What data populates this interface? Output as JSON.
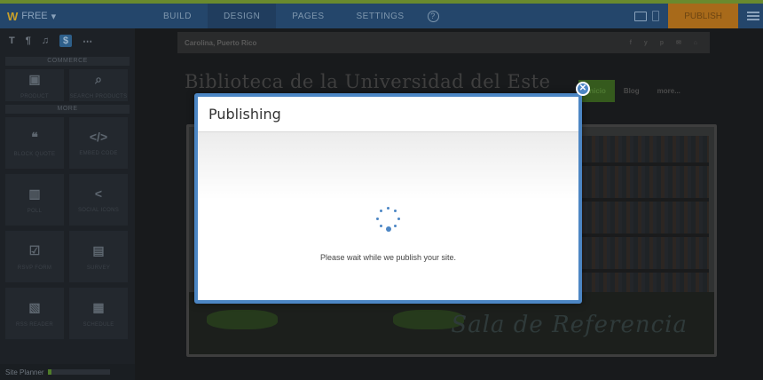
{
  "topbar": {
    "brand_label": "FREE",
    "brand_caret": "▾",
    "tabs": [
      {
        "label": "BUILD"
      },
      {
        "label": "DESIGN"
      },
      {
        "label": "PAGES"
      },
      {
        "label": "SETTINGS"
      }
    ],
    "help_glyph": "?",
    "publish_label": "PUBLISH",
    "icons": [
      "desktop-icon",
      "mobile-icon",
      "menu-icon"
    ]
  },
  "sidebar": {
    "tools": [
      {
        "label": "T",
        "icon": "title-icon"
      },
      {
        "label": "¶",
        "icon": "paragraph-icon"
      },
      {
        "label": "♫",
        "icon": "audio-icon"
      },
      {
        "label": "$",
        "icon": "dollar-icon",
        "active": true
      },
      {
        "label": "⋯",
        "icon": "more-icon"
      }
    ],
    "commerce_heading": "COMMERCE",
    "commerce_items": [
      {
        "label": "PRODUCT",
        "icon": "product-icon",
        "glyph": "▣"
      },
      {
        "label": "SEARCH PRODUCTS",
        "icon": "search-products-icon",
        "glyph": "⌕"
      }
    ],
    "more_heading": "MORE",
    "more_items": [
      {
        "label": "BLOCK QUOTE",
        "icon": "quote-icon",
        "glyph": "❝"
      },
      {
        "label": "EMBED CODE",
        "icon": "code-icon",
        "glyph": "</>"
      },
      {
        "label": "POLL",
        "icon": "poll-icon",
        "glyph": "▥"
      },
      {
        "label": "SOCIAL ICONS",
        "icon": "share-icon",
        "glyph": "<"
      },
      {
        "label": "RSVP FORM",
        "icon": "rsvp-icon",
        "glyph": "☑"
      },
      {
        "label": "SURVEY",
        "icon": "survey-icon",
        "glyph": "▤"
      },
      {
        "label": "RSS READER",
        "icon": "rss-icon",
        "glyph": "▧"
      },
      {
        "label": "SCHEDULE",
        "icon": "schedule-icon",
        "glyph": "▦"
      }
    ],
    "planner_label": "Site Planner",
    "planner_progress": 0.06
  },
  "site": {
    "location": "Carolina, Puerto Rico",
    "social_glyphs": "f  y  p  ✉  ⌂",
    "title": "Biblioteca de la Universidad del Este",
    "nav": [
      {
        "label": "Inicio",
        "active": true
      },
      {
        "label": "Blog"
      },
      {
        "label": "more..."
      }
    ],
    "banner_caption": "Sala de Referencia"
  },
  "modal": {
    "title": "Publishing",
    "message": "Please wait while we publish your site.",
    "close_glyph": "✕"
  },
  "colors": {
    "accent": "#4c86c4",
    "publish": "#e5921e",
    "topbar": "#2e5b8f"
  }
}
